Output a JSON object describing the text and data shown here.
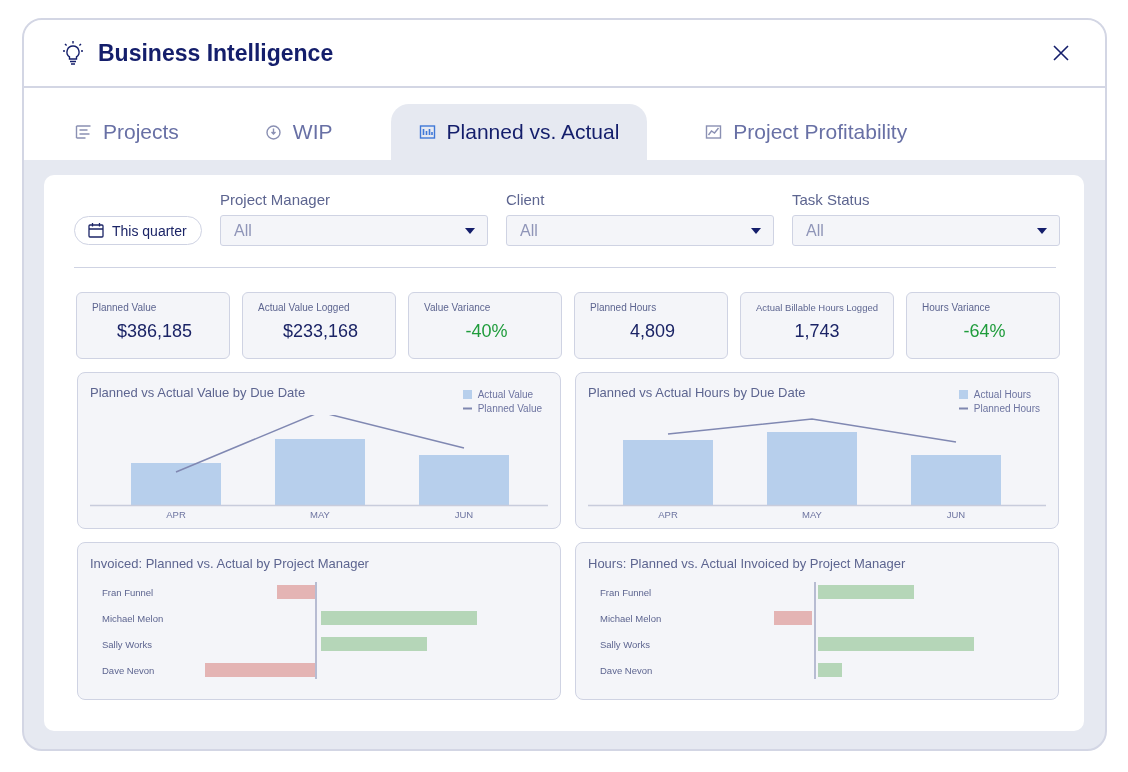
{
  "window": {
    "title": "Business Intelligence"
  },
  "tabs": [
    {
      "label": "Projects",
      "selected": false
    },
    {
      "label": "WIP",
      "selected": false
    },
    {
      "label": "Planned vs. Actual",
      "selected": true
    },
    {
      "label": "Project Profitability",
      "selected": false
    }
  ],
  "date_button": {
    "label": "This quarter"
  },
  "filters": [
    {
      "label": "Project Manager",
      "value": "All"
    },
    {
      "label": "Client",
      "value": "All"
    },
    {
      "label": "Task Status",
      "value": "All"
    }
  ],
  "kpis": [
    {
      "label": "Planned Value",
      "value": "$386,185",
      "color": "#1b2466"
    },
    {
      "label": "Actual Value Logged",
      "value": "$233,168",
      "color": "#1b2466"
    },
    {
      "label": "Value Variance",
      "value": "-40%",
      "color": "#1f9c3c"
    },
    {
      "label": "Planned Hours",
      "value": "4,809",
      "color": "#1b2466"
    },
    {
      "label": "Actual Billable Hours Logged",
      "value": "1,743",
      "color": "#1b2466"
    },
    {
      "label": "Hours Variance",
      "value": "-64%",
      "color": "#1f9c3c"
    }
  ],
  "column_charts": [
    {
      "title": "Planned vs Actual Value by Due Date",
      "legend": [
        "Actual Value",
        "Planned Value"
      ],
      "categories": [
        "APR",
        "MAY",
        "JUN"
      ]
    },
    {
      "title": "Planned vs Actual Hours by Due Date",
      "legend": [
        "Actual Hours",
        "Planned Hours"
      ],
      "categories": [
        "APR",
        "MAY",
        "JUN"
      ]
    }
  ],
  "manager_charts": [
    {
      "title": "Invoiced: Planned vs. Actual by Project Manager",
      "categories": [
        "Fran Funnel",
        "Michael Melon",
        "Sally Works",
        "Dave Nevon"
      ]
    },
    {
      "title": "Hours: Planned vs. Actual Invoiced by Project Manager",
      "categories": [
        "Fran Funnel",
        "Michael Melon",
        "Sally Works",
        "Dave Nevon"
      ]
    }
  ]
}
